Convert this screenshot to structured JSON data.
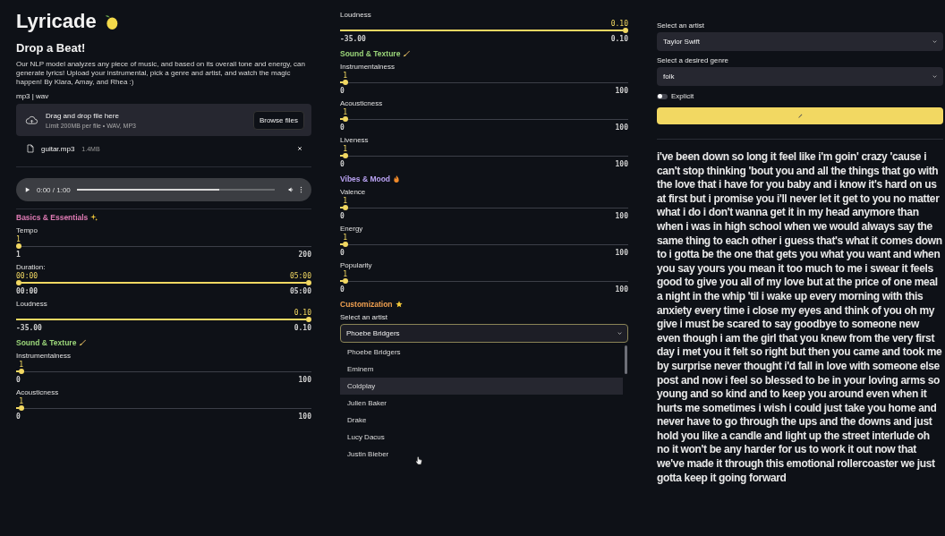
{
  "title": "Lyricade",
  "subtitle": "Drop a Beat!",
  "intro": "Our NLP model analyzes any piece of music, and based on its overall tone and energy, can generate lyrics! Upload your instrumental, pick a genre and artist, and watch the magic happen! By Klara, Amay, and Rhea :)",
  "uploader": {
    "label": "mp3 | wav",
    "prompt": "Drag and drop file here",
    "limit": "Limit 200MB per file • WAV, MP3",
    "button": "Browse files"
  },
  "file": {
    "name": "guitar.mp3",
    "size": "1.4MB"
  },
  "player": {
    "time": "0:00 / 1:00",
    "level": 0.72
  },
  "left_controls": [
    {
      "kind": "heading",
      "text": "Basics & Essentials",
      "color": "#e07bb5"
    },
    {
      "kind": "slider",
      "label": "Tempo",
      "value": "1",
      "min": "1",
      "max": "200",
      "level": 0
    },
    {
      "kind": "range",
      "label": "Duration:",
      "value": "00:00",
      "value_end": "05:00",
      "min": "00:00",
      "max": "05:00",
      "level": 1
    },
    {
      "kind": "slider",
      "label": "Loudness",
      "value": "0.10",
      "min": "-35.00",
      "max": "0.10",
      "level": 1
    },
    {
      "kind": "heading",
      "text": "Sound & Texture",
      "color": "#9bd67a"
    },
    {
      "kind": "slider",
      "label": "Instrumentalness",
      "value": "1",
      "min": "0",
      "max": "100",
      "level": 0.01
    },
    {
      "kind": "slider",
      "label": "Acousticness",
      "value": "1",
      "min": "0",
      "max": "100",
      "level": 0.01
    }
  ],
  "middle_controls": [
    {
      "kind": "slider",
      "label": "Loudness",
      "value": "0.10",
      "min": "-35.00",
      "max": "0.10",
      "level": 1
    },
    {
      "kind": "heading",
      "text": "Sound & Texture",
      "color": "#9bd67a"
    },
    {
      "kind": "slider",
      "label": "Instrumentalness",
      "value": "1",
      "min": "0",
      "max": "100",
      "level": 0.01
    },
    {
      "kind": "slider",
      "label": "Acousticness",
      "value": "1",
      "min": "0",
      "max": "100",
      "level": 0.01
    },
    {
      "kind": "slider",
      "label": "Liveness",
      "value": "1",
      "min": "0",
      "max": "100",
      "level": 0.01
    },
    {
      "kind": "heading",
      "text": "Vibes & Mood",
      "color": "#b9a2f2"
    },
    {
      "kind": "slider",
      "label": "Valence",
      "value": "1",
      "min": "0",
      "max": "100",
      "level": 0.01
    },
    {
      "kind": "slider",
      "label": "Energy",
      "value": "1",
      "min": "0",
      "max": "100",
      "level": 0.01
    },
    {
      "kind": "slider",
      "label": "Popularity",
      "value": "1",
      "min": "0",
      "max": "100",
      "level": 0.01
    },
    {
      "kind": "heading",
      "text": "Customization",
      "color": "#f0a050"
    },
    {
      "kind": "select",
      "label": "Select an artist",
      "value": "Phoebe Bridgers",
      "expanded": true,
      "options": [
        {
          "text": "Phoebe Bridgers",
          "hovered": false
        },
        {
          "text": "Eminem",
          "hovered": false
        },
        {
          "text": "Coldplay",
          "hovered": true
        },
        {
          "text": "Julien Baker",
          "hovered": false
        },
        {
          "text": "Drake",
          "hovered": false
        },
        {
          "text": "Lucy Dacus",
          "hovered": false
        },
        {
          "text": "Justin Bieber",
          "hovered": false
        }
      ]
    }
  ],
  "right": {
    "selects": [
      {
        "label": "Select an artist",
        "value": "Taylor Swift"
      },
      {
        "label": "Select a desired genre",
        "value": "folk"
      }
    ],
    "explicit": {
      "label": "Explicit",
      "on": false
    },
    "lyrics": "i've been down so long it feel like i'm goin' crazy 'cause i can't stop thinking 'bout you and all the things that go with the love that i have for you baby and i know it's hard on us at first but i promise you i'll never let it get to you no matter what i do i don't wanna get it in my head anymore than when i was in high school when we would always say the same thing to each other i guess that's what it comes down to i gotta be the one that gets you what you want and when you say yours you mean it too much to me i swear it feels good to give you all of my love but at the price of one meal a night in the whip 'til i wake up every morning with this anxiety every time i close my eyes and think of you oh my give i must be scared to say goodbye to someone new even though i am the girl that you knew from the very first day i met you it felt so right but then you came and took me by surprise never thought i'd fall in love with someone else post and now i feel so blessed to be in your loving arms so young and so kind and to keep you around even when it hurts me sometimes i wish i could just take you home and never have to go through the ups and the downs and just hold you like a candle and light up the street interlude oh no it won't be any harder for us to work it out now that we've made it through this emotional rollercoaster we just gotta keep it going forward"
  }
}
